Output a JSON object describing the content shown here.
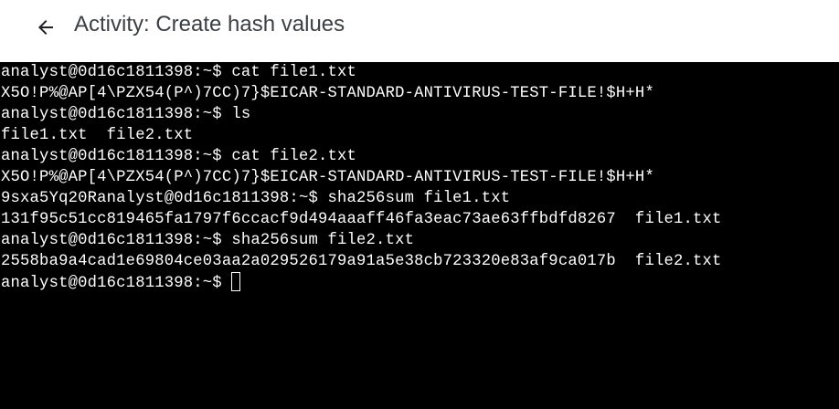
{
  "header": {
    "back_icon": "arrow-left-icon",
    "title": "Activity: Create hash values"
  },
  "terminal": {
    "lines": [
      "analyst@0d16c1811398:~$ cat file1.txt",
      "X5O!P%@AP[4\\PZX54(P^)7CC)7}$EICAR-STANDARD-ANTIVIRUS-TEST-FILE!$H+H*",
      "analyst@0d16c1811398:~$ ls",
      "file1.txt  file2.txt",
      "analyst@0d16c1811398:~$ cat file2.txt",
      "X5O!P%@AP[4\\PZX54(P^)7CC)7}$EICAR-STANDARD-ANTIVIRUS-TEST-FILE!$H+H*",
      "9sxa5Yq20Ranalyst@0d16c1811398:~$ sha256sum file1.txt",
      "131f95c51cc819465fa1797f6ccacf9d494aaaff46fa3eac73ae63ffbdfd8267  file1.txt",
      "analyst@0d16c1811398:~$ sha256sum file2.txt",
      "2558ba9a4cad1e69804ce03aa2a029526179a91a5e38cb723320e83af9ca017b  file2.txt"
    ],
    "prompt": "analyst@0d16c1811398:~$ "
  },
  "colors": {
    "terminal_bg": "#000000",
    "terminal_fg": "#ffffff",
    "header_bg": "#ffffff",
    "title_color": "#3c4043"
  }
}
